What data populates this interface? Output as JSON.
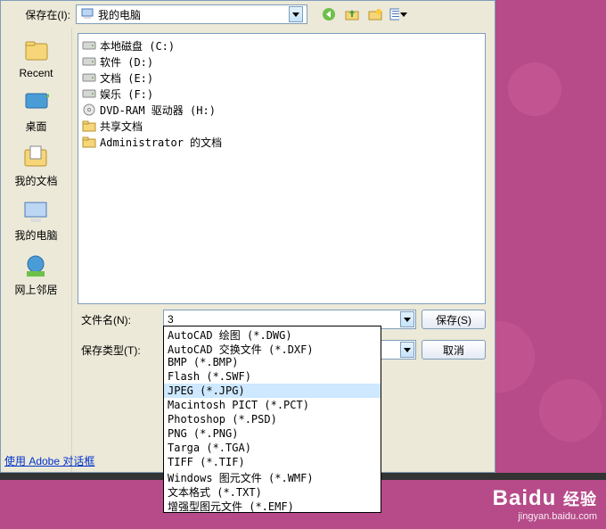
{
  "toprow": {
    "save_in_label": "保存在(I):",
    "location": "我的电脑"
  },
  "sidebar": {
    "places": [
      {
        "label": "Recent",
        "icon": "recent"
      },
      {
        "label": "桌面",
        "icon": "desktop"
      },
      {
        "label": "我的文档",
        "icon": "mydocs"
      },
      {
        "label": "我的电脑",
        "icon": "mycomputer"
      },
      {
        "label": "网上邻居",
        "icon": "network"
      }
    ]
  },
  "filelist": [
    {
      "label": "本地磁盘 (C:)",
      "icon": "hdd"
    },
    {
      "label": "软件 (D:)",
      "icon": "hdd"
    },
    {
      "label": "文档 (E:)",
      "icon": "hdd"
    },
    {
      "label": "娱乐 (F:)",
      "icon": "hdd"
    },
    {
      "label": "DVD-RAM 驱动器 (H:)",
      "icon": "dvd"
    },
    {
      "label": "共享文档",
      "icon": "folder"
    },
    {
      "label": "Administrator 的文档",
      "icon": "folder"
    }
  ],
  "form": {
    "filename_label": "文件名(N):",
    "filename_value": "3",
    "filetype_label": "保存类型(T):",
    "filetype_value": "JPEG (*.JPG)",
    "save_btn": "保存(S)",
    "cancel_btn": "取消"
  },
  "filetype_options": [
    "AutoCAD 绘图 (*.DWG)",
    "AutoCAD 交换文件 (*.DXF)",
    "BMP (*.BMP)",
    "Flash (*.SWF)",
    "JPEG (*.JPG)",
    "Macintosh PICT (*.PCT)",
    "Photoshop (*.PSD)",
    "PNG (*.PNG)",
    "Targa (*.TGA)",
    "TIFF (*.TIF)",
    "Windows 图元文件 (*.WMF)",
    "文本格式 (*.TXT)",
    "增强型图元文件 (*.EMF)"
  ],
  "filetype_selected_index": 4,
  "bottom_link": "使用 Adobe 对话框",
  "watermark": {
    "brand": "Baidu",
    "suffix": "经验",
    "url": "jingyan.baidu.com"
  }
}
